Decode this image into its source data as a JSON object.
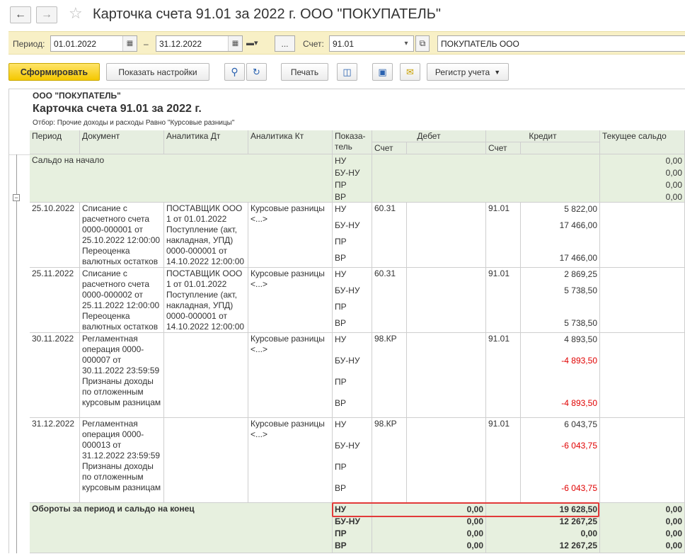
{
  "window": {
    "title": "Карточка счета 91.01 за 2022 г. ООО \"ПОКУПАТЕЛЬ\""
  },
  "filters": {
    "period_label": "Период:",
    "date_from": "01.01.2022",
    "dash": "–",
    "date_to": "31.12.2022",
    "more": "...",
    "account_label": "Счет:",
    "account": "91.01",
    "org": "ПОКУПАТЕЛЬ ООО"
  },
  "toolbar": {
    "generate": "Сформировать",
    "show_settings": "Показать настройки",
    "print": "Печать",
    "register": "Регистр учета"
  },
  "report": {
    "org": "ООО \"ПОКУПАТЕЛЬ\"",
    "title": "Карточка счета 91.01 за 2022 г.",
    "filter": "Отбор: Прочие доходы и расходы Равно \"Курсовые разницы\"",
    "headers": {
      "period": "Период",
      "document": "Документ",
      "an_dt": "Аналитика Дт",
      "an_kt": "Аналитика Кт",
      "indicator": "Показа-тель",
      "debit": "Дебет",
      "credit": "Кредит",
      "balance": "Текущее сальдо",
      "account": "Счет"
    },
    "opening": {
      "label": "Сальдо на начало",
      "indicators": [
        "НУ",
        "БУ-НУ",
        "ПР",
        "ВР"
      ],
      "balance": [
        "0,00",
        "0,00",
        "0,00",
        "0,00"
      ]
    },
    "rows": [
      {
        "period": "25.10.2022",
        "document": "Списание с расчетного счета 0000-000001 от 25.10.2022 12:00:00 Переоценка валютных остатков",
        "an_dt": "ПОСТАВЩИК ООО 1 от 01.01.2022 Поступление (акт, накладная, УПД) 0000-000001 от 14.10.2022 12:00:00",
        "an_kt": "Курсовые разницы <...>",
        "indicators": [
          "НУ",
          "БУ-НУ",
          "ПР",
          "ВР"
        ],
        "debit_acc": "60.31",
        "credit_acc": "91.01",
        "credit": [
          "5 822,00",
          "17 466,00",
          "",
          "17 466,00"
        ]
      },
      {
        "period": "25.11.2022",
        "document": "Списание с расчетного счета 0000-000002 от 25.11.2022 12:00:00 Переоценка валютных остатков",
        "an_dt": "ПОСТАВЩИК ООО 1 от 01.01.2022 Поступление (акт, накладная, УПД) 0000-000001 от 14.10.2022 12:00:00",
        "an_kt": "Курсовые разницы <...>",
        "indicators": [
          "НУ",
          "БУ-НУ",
          "ПР",
          "ВР"
        ],
        "debit_acc": "60.31",
        "credit_acc": "91.01",
        "credit": [
          "2 869,25",
          "5 738,50",
          "",
          "5 738,50"
        ]
      },
      {
        "period": "30.11.2022",
        "document": "Регламентная операция 0000-000007 от 30.11.2022 23:59:59 Признаны доходы по отложенным курсовым разницам",
        "an_dt": "",
        "an_kt": "Курсовые разницы <...>",
        "indicators": [
          "НУ",
          "БУ-НУ",
          "ПР",
          "ВР"
        ],
        "debit_acc": "98.КР",
        "credit_acc": "91.01",
        "credit": [
          "4 893,50",
          "-4 893,50",
          "",
          "-4 893,50"
        ]
      },
      {
        "period": "31.12.2022",
        "document": "Регламентная операция 0000-000013 от 31.12.2022 23:59:59 Признаны доходы по отложенным курсовым разницам",
        "an_dt": "",
        "an_kt": "Курсовые разницы <...>",
        "indicators": [
          "НУ",
          "БУ-НУ",
          "ПР",
          "ВР"
        ],
        "debit_acc": "98.КР",
        "credit_acc": "91.01",
        "credit": [
          "6 043,75",
          "-6 043,75",
          "",
          "-6 043,75"
        ]
      }
    ],
    "totals": {
      "label": "Обороты за период и сальдо на конец",
      "indicators": [
        "НУ",
        "БУ-НУ",
        "ПР",
        "ВР"
      ],
      "debit": [
        "0,00",
        "0,00",
        "0,00",
        "0,00"
      ],
      "credit": [
        "19 628,50",
        "12 267,25",
        "0,00",
        "12 267,25"
      ],
      "balance": [
        "0,00",
        "0,00",
        "0,00",
        "0,00"
      ]
    }
  },
  "colors": {
    "accent": "#f4c800",
    "negative": "#e00000",
    "highlight": "#e23a3a",
    "header_bg": "#e6eee0"
  }
}
